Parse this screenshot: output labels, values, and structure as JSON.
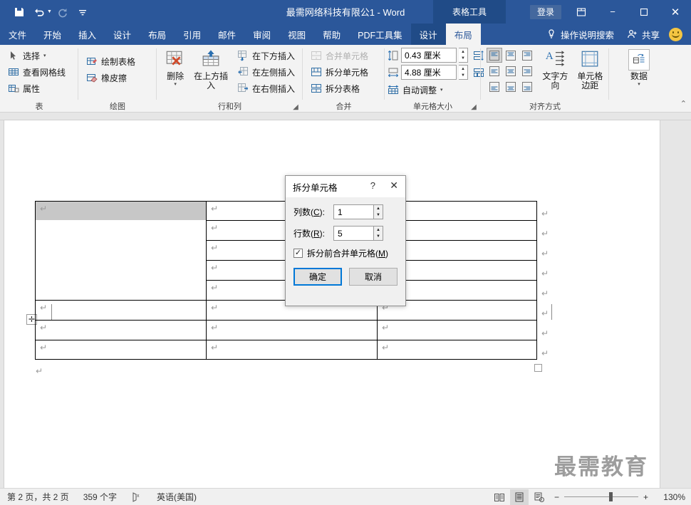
{
  "titlebar": {
    "document_title": "最需网络科技有限公1 - Word",
    "context_tab_group": "表格工具",
    "signin_label": "登录",
    "qat": [
      {
        "name": "save-icon",
        "label": "保存"
      },
      {
        "name": "undo-icon",
        "label": "撤消"
      },
      {
        "name": "redo-icon",
        "label": "恢复"
      },
      {
        "name": "customize-qat-icon",
        "label": "自定义快速访问工具栏"
      }
    ],
    "window_buttons": [
      {
        "name": "ribbon-display-options-icon",
        "glyph": "⊡"
      },
      {
        "name": "minimize-icon",
        "glyph": "−"
      },
      {
        "name": "maximize-icon",
        "glyph": "☐"
      },
      {
        "name": "close-icon",
        "glyph": "✕"
      }
    ]
  },
  "tabs": [
    {
      "label": "文件",
      "state": "file"
    },
    {
      "label": "开始",
      "state": "normal"
    },
    {
      "label": "插入",
      "state": "normal"
    },
    {
      "label": "设计",
      "state": "normal"
    },
    {
      "label": "布局",
      "state": "normal"
    },
    {
      "label": "引用",
      "state": "normal"
    },
    {
      "label": "邮件",
      "state": "normal"
    },
    {
      "label": "审阅",
      "state": "normal"
    },
    {
      "label": "视图",
      "state": "normal"
    },
    {
      "label": "帮助",
      "state": "normal"
    },
    {
      "label": "PDF工具集",
      "state": "normal"
    },
    {
      "label": "设计",
      "state": "context"
    },
    {
      "label": "布局",
      "state": "active"
    }
  ],
  "tabbar_right": {
    "tellme_label": "操作说明搜索",
    "share_label": "共享"
  },
  "ribbon": {
    "groups": [
      {
        "name": "table",
        "label": "表",
        "items": [
          {
            "label": "选择",
            "icon": "select-arrow-icon",
            "has_caret": true
          },
          {
            "label": "查看网格线",
            "icon": "view-gridlines-icon",
            "has_caret": false
          },
          {
            "label": "属性",
            "icon": "table-properties-icon",
            "has_caret": false
          }
        ]
      },
      {
        "name": "draw",
        "label": "绘图",
        "items": [
          {
            "label": "绘制表格",
            "icon": "draw-table-icon",
            "has_caret": false
          },
          {
            "label": "橡皮擦",
            "icon": "eraser-icon",
            "has_caret": false
          }
        ]
      },
      {
        "name": "rows-columns",
        "label": "行和列",
        "big_items": [
          {
            "label": "删除",
            "icon": "delete-table-icon",
            "has_caret": true
          },
          {
            "label": "在上方插入",
            "icon": "insert-above-icon",
            "has_caret": false
          }
        ],
        "items": [
          {
            "label": "在下方插入",
            "icon": "insert-below-icon"
          },
          {
            "label": "在左侧插入",
            "icon": "insert-left-icon"
          },
          {
            "label": "在右侧插入",
            "icon": "insert-right-icon"
          }
        ],
        "has_dialog_launcher": true
      },
      {
        "name": "merge",
        "label": "合并",
        "items": [
          {
            "label": "合并单元格",
            "icon": "merge-cells-icon",
            "disabled": true
          },
          {
            "label": "拆分单元格",
            "icon": "split-cells-icon",
            "disabled": false
          },
          {
            "label": "拆分表格",
            "icon": "split-table-icon",
            "disabled": false
          }
        ]
      },
      {
        "name": "cell-size",
        "label": "单元格大小",
        "height_value": "0.43 厘米",
        "width_value": "4.88 厘米",
        "autofit_label": "自动调整",
        "distribute_rows_icon": "distribute-rows-icon",
        "distribute_cols_icon": "distribute-columns-icon",
        "has_dialog_launcher": true
      },
      {
        "name": "alignment",
        "label": "对齐方式",
        "text_direction_label": "文字方向",
        "cell_margins_label": "单元格边距",
        "selected_alignment_index": 0
      },
      {
        "name": "data",
        "label": "",
        "data_label": "数据"
      }
    ],
    "collapse_glyph": "⌃"
  },
  "document": {
    "table": {
      "rows": 8,
      "merged_first_cell_selected": true,
      "paragraph_mark": "↵"
    },
    "watermark": "最需教育"
  },
  "dialog": {
    "title": "拆分单元格",
    "help_glyph": "?",
    "close_glyph": "✕",
    "columns": {
      "label_prefix": "列数(",
      "label_key": "C",
      "label_suffix": "):",
      "value": "1"
    },
    "rows": {
      "label_prefix": "行数(",
      "label_key": "R",
      "label_suffix": "):",
      "value": "5"
    },
    "checkbox": {
      "label_prefix": "拆分前合并单元格(",
      "label_key": "M",
      "label_suffix": ")",
      "checked": true,
      "glyph": "✓"
    },
    "ok_label": "确定",
    "cancel_label": "取消"
  },
  "statusbar": {
    "page_info": "第 2 页，共 2 页",
    "word_count": "359 个字",
    "proofing_icon": "spell-check-icon",
    "language": "英语(美国)",
    "views": [
      {
        "name": "read-mode-view-button",
        "active": false
      },
      {
        "name": "print-layout-view-button",
        "active": true
      },
      {
        "name": "web-layout-view-button",
        "active": false
      }
    ],
    "zoom_out": "−",
    "zoom_in": "+",
    "zoom_level": "130%"
  }
}
